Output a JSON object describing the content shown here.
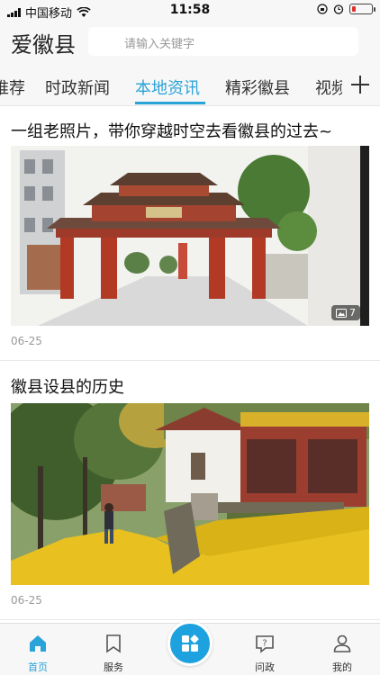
{
  "status_bar": {
    "carrier": "中国移动",
    "time": "11:58"
  },
  "header": {
    "title": "爱徽县",
    "search_placeholder": "请输入关键字"
  },
  "tabs": [
    {
      "label": "推荐"
    },
    {
      "label": "时政新闻"
    },
    {
      "label": "本地资讯",
      "active": true
    },
    {
      "label": "精彩徽县"
    },
    {
      "label": "视频"
    }
  ],
  "articles": [
    {
      "title": "一组老照片，带你穿越时空去看徽县的过去~",
      "photo_count": "7",
      "date": "06-25"
    },
    {
      "title": "徽县设县的历史",
      "date": "06-25"
    }
  ],
  "tabbar": {
    "items": [
      {
        "label": "首页",
        "active": true,
        "icon": "home-icon"
      },
      {
        "label": "服务",
        "icon": "bookmark-icon"
      },
      {
        "label": "",
        "icon": "apps-icon"
      },
      {
        "label": "问政",
        "icon": "question-icon"
      },
      {
        "label": "我的",
        "icon": "user-icon"
      }
    ]
  },
  "colors": {
    "accent": "#2aa3d8",
    "center_button": "#1ea2df"
  }
}
